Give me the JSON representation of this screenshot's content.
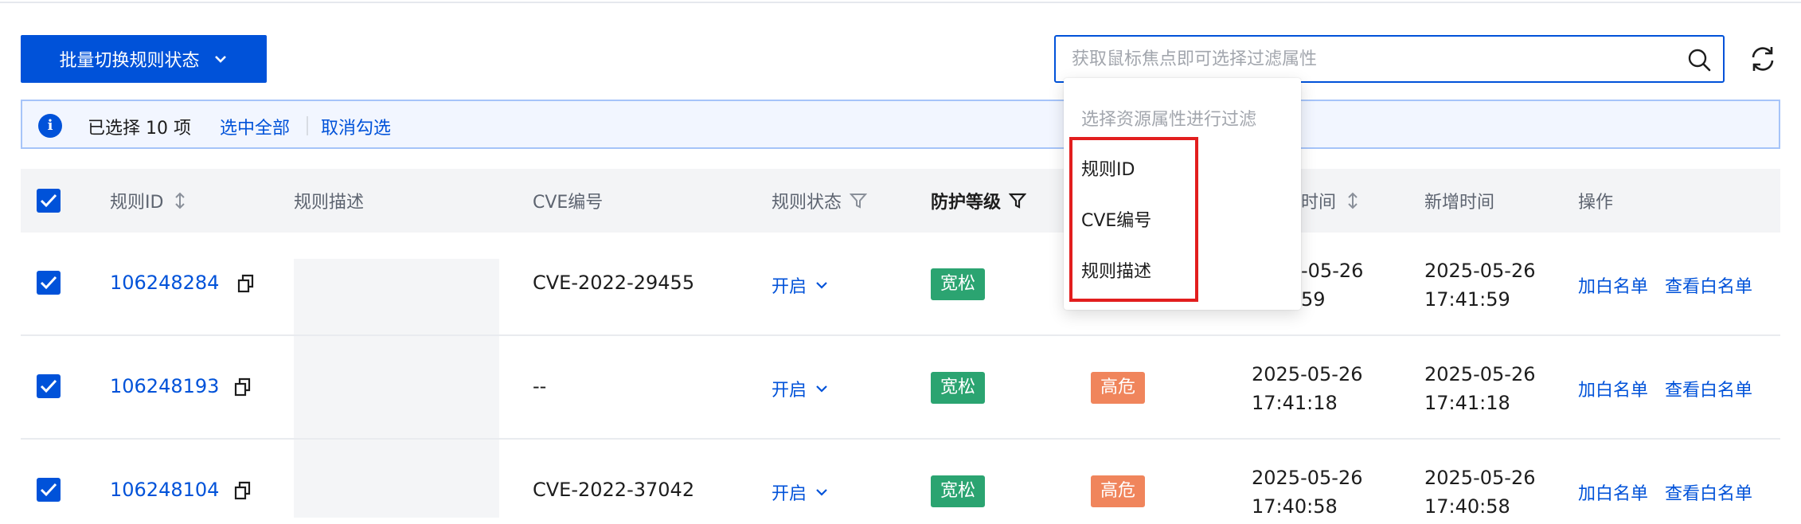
{
  "toolbar": {
    "batch_label": "批量切换规则状态"
  },
  "search": {
    "placeholder": "获取鼠标焦点即可选择过滤属性",
    "value": ""
  },
  "selection": {
    "text": "已选择 10 项",
    "select_all": "选中全部",
    "cancel": "取消勾选"
  },
  "columns": {
    "rule_id": "规则ID",
    "description": "规则描述",
    "cve": "CVE编号",
    "status": "规则状态",
    "protection": "防护等级",
    "updated": "时间",
    "added": "新增时间",
    "actions": "操作"
  },
  "rows": [
    {
      "id": "106248284",
      "cve": "CVE-2022-29455",
      "status": "开启",
      "protection": "宽松",
      "risk": "",
      "updated_date": "-05-26",
      "updated_time": "59",
      "added_date": "2025-05-26",
      "added_time": "17:41:59",
      "whitelist_add": "加白名单",
      "whitelist_view": "查看白名单"
    },
    {
      "id": "106248193",
      "cve": "--",
      "status": "开启",
      "protection": "宽松",
      "risk": "高危",
      "updated_date": "2025-05-26",
      "updated_time": "17:41:18",
      "added_date": "2025-05-26",
      "added_time": "17:41:18",
      "whitelist_add": "加白名单",
      "whitelist_view": "查看白名单"
    },
    {
      "id": "106248104",
      "cve": "CVE-2022-37042",
      "status": "开启",
      "protection": "宽松",
      "risk": "高危",
      "updated_date": "2025-05-26",
      "updated_time": "17:40:58",
      "added_date": "2025-05-26",
      "added_time": "17:40:58",
      "whitelist_add": "加白名单",
      "whitelist_view": "查看白名单"
    }
  ],
  "dropdown": {
    "hint": "选择资源属性进行过滤",
    "options": [
      "规则ID",
      "CVE编号",
      "规则描述"
    ]
  },
  "colors": {
    "primary": "#0052d9",
    "success": "#2ba471",
    "danger": "#f0855c",
    "annotation": "#e21e1e"
  }
}
